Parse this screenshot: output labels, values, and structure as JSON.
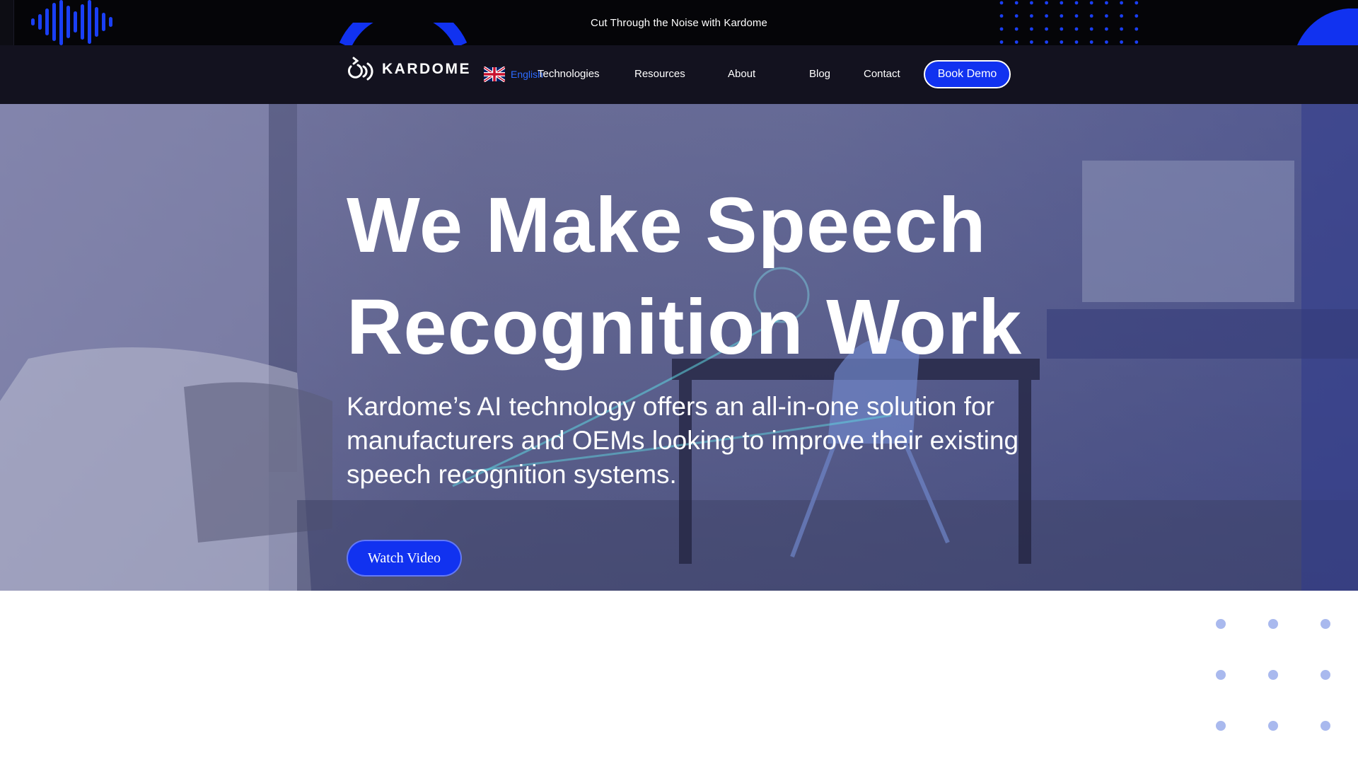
{
  "promo": {
    "text": "Cut Through the Noise with Kardome"
  },
  "nav": {
    "logo_text": "KARDOME",
    "language": "English",
    "links": [
      {
        "label": "Technologies"
      },
      {
        "label": "Resources"
      },
      {
        "label": "About"
      },
      {
        "label": "Blog"
      },
      {
        "label": "Contact"
      }
    ],
    "cta_label": "Book Demo"
  },
  "hero": {
    "title_line1": "We Make Speech",
    "title_line2": "Recognition Work",
    "subtitle": "Kardome’s AI technology offers an all-in-one solution for manufacturers and OEMs looking to improve their existing speech recognition systems.",
    "cta_label": "Watch Video"
  },
  "colors": {
    "brand_blue": "#1132f0",
    "nav_bg": "#13121f",
    "promo_bg": "#050508",
    "accent_link": "#2d6bff"
  },
  "icons": [
    "sound-wave-icon",
    "kardome-logo-icon",
    "uk-flag-icon"
  ]
}
